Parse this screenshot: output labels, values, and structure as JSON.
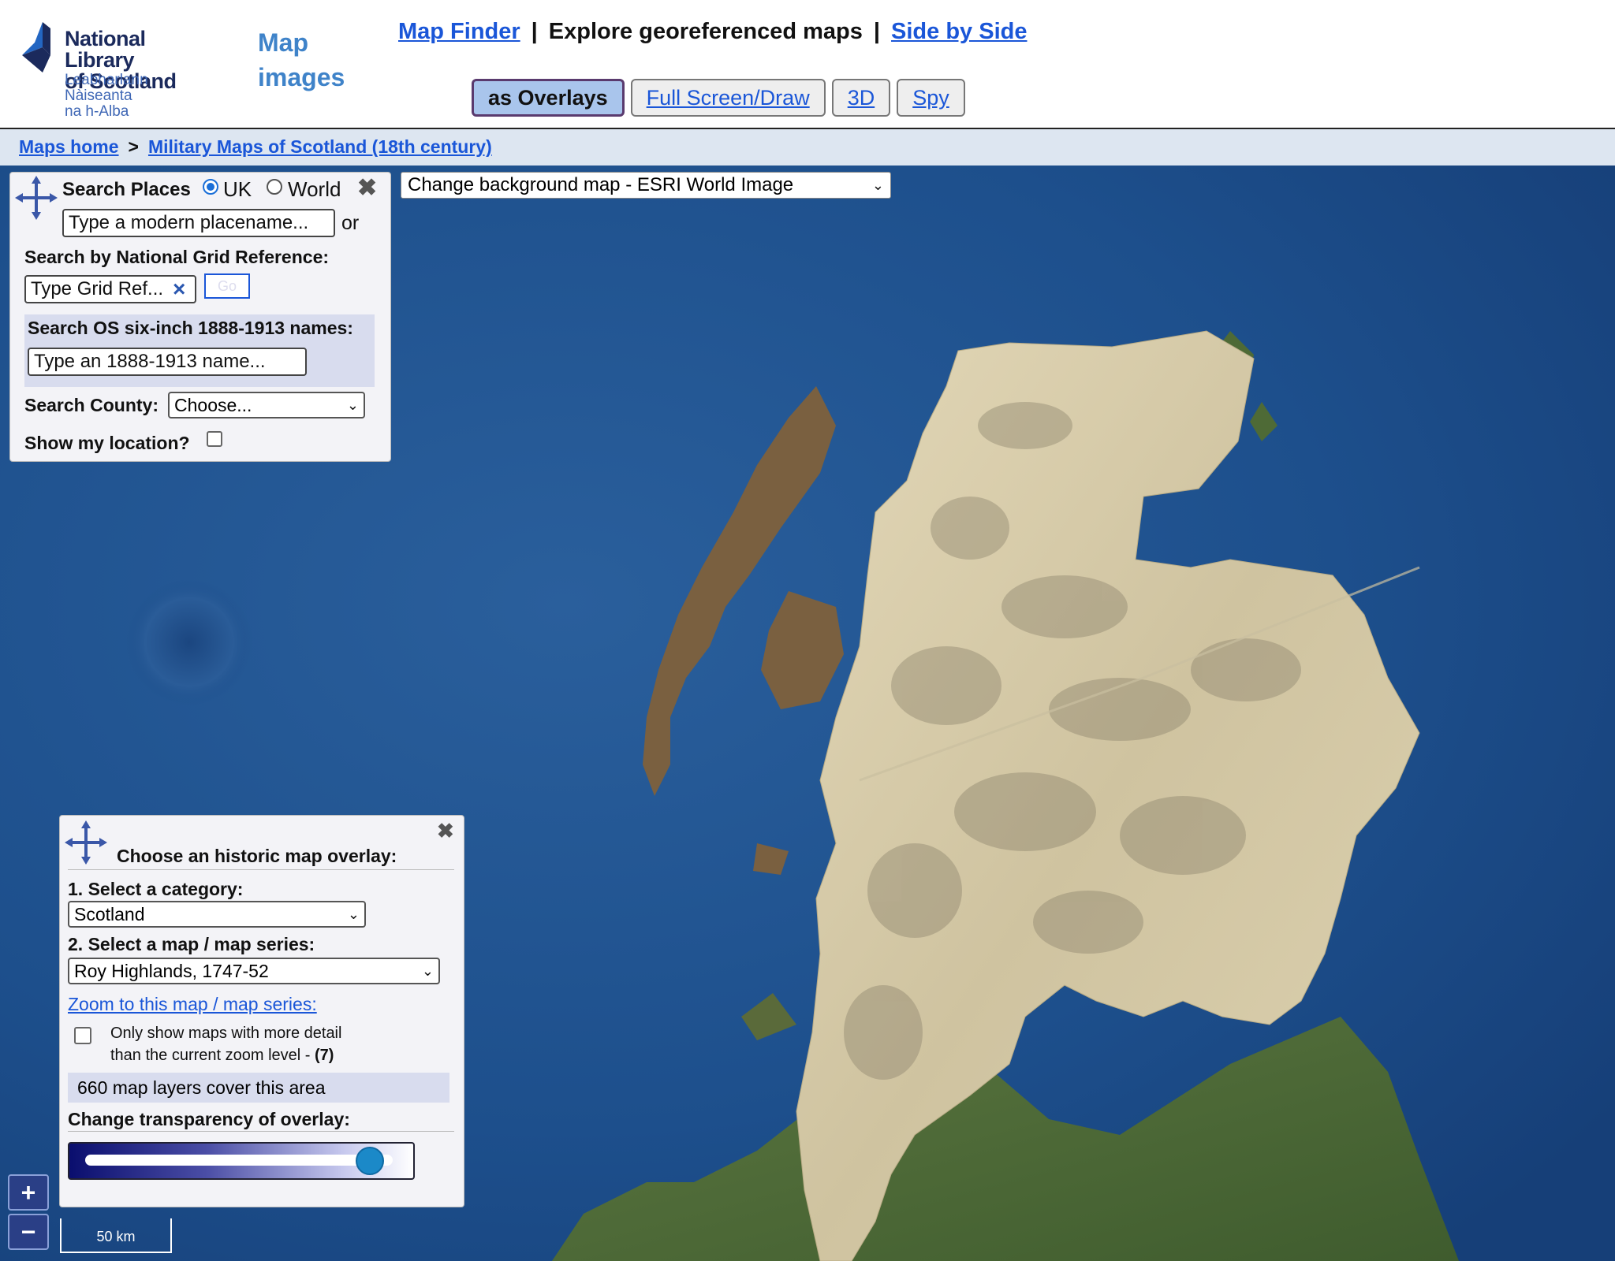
{
  "logo": {
    "line1": "National Library",
    "line2": "of Scotland",
    "line3": "Leabharlann Nàiseanta",
    "line4": "na h-Alba"
  },
  "site_title": {
    "line1": "Map",
    "line2": "images"
  },
  "nav": {
    "map_finder": "Map Finder",
    "sep1": "|",
    "explore": "Explore georeferenced maps",
    "sep2": "|",
    "side_by_side": "Side by Side"
  },
  "view_tabs": [
    {
      "label": "as Overlays",
      "active": true
    },
    {
      "label": "Full Screen/Draw",
      "active": false
    },
    {
      "label": "3D",
      "active": false
    },
    {
      "label": "Spy",
      "active": false
    }
  ],
  "breadcrumb": {
    "home": "Maps home",
    "sep": ">",
    "current": "Military Maps of Scotland (18th century)"
  },
  "background_select": {
    "value": "Change background map - ESRI World Image"
  },
  "search_panel": {
    "title": "Search Places",
    "opt_uk": "UK",
    "opt_world": "World",
    "selected": "UK",
    "place_placeholder": "Type a modern placename...",
    "or": "or",
    "grid_label": "Search by National Grid Reference:",
    "grid_placeholder": "Type Grid Ref...",
    "grid_clear": "×",
    "go": "Go",
    "os_label": "Search OS six-inch 1888-1913 names:",
    "os_placeholder": "Type an 1888-1913 name...",
    "county_label": "Search County:",
    "county_value": "Choose...",
    "location_label": "Show my location?",
    "close": "✖"
  },
  "overlay_panel": {
    "title": "Choose an historic map overlay:",
    "cat_label": "1. Select a category:",
    "cat_value": "Scotland",
    "series_label": "2. Select a map / map series:",
    "series_value": "Roy Highlands, 1747-52",
    "zoom_link": "Zoom to this map / map series:",
    "detail_line1": "Only show maps with more detail",
    "detail_line2": "than the current zoom level - ",
    "zoom_level": "(7)",
    "layers_count": "660 map layers cover this area",
    "transparency_label": "Change transparency of overlay:",
    "transparency": 0.97,
    "close": "✖"
  },
  "zoom": {
    "in": "+",
    "out": "−"
  },
  "scale_bar": "50 km",
  "colors": {
    "accent": "#1a56d8",
    "sea": "#1d4f8c",
    "land": "#4f6d3a",
    "overlay_map": "#d9ceaa"
  }
}
